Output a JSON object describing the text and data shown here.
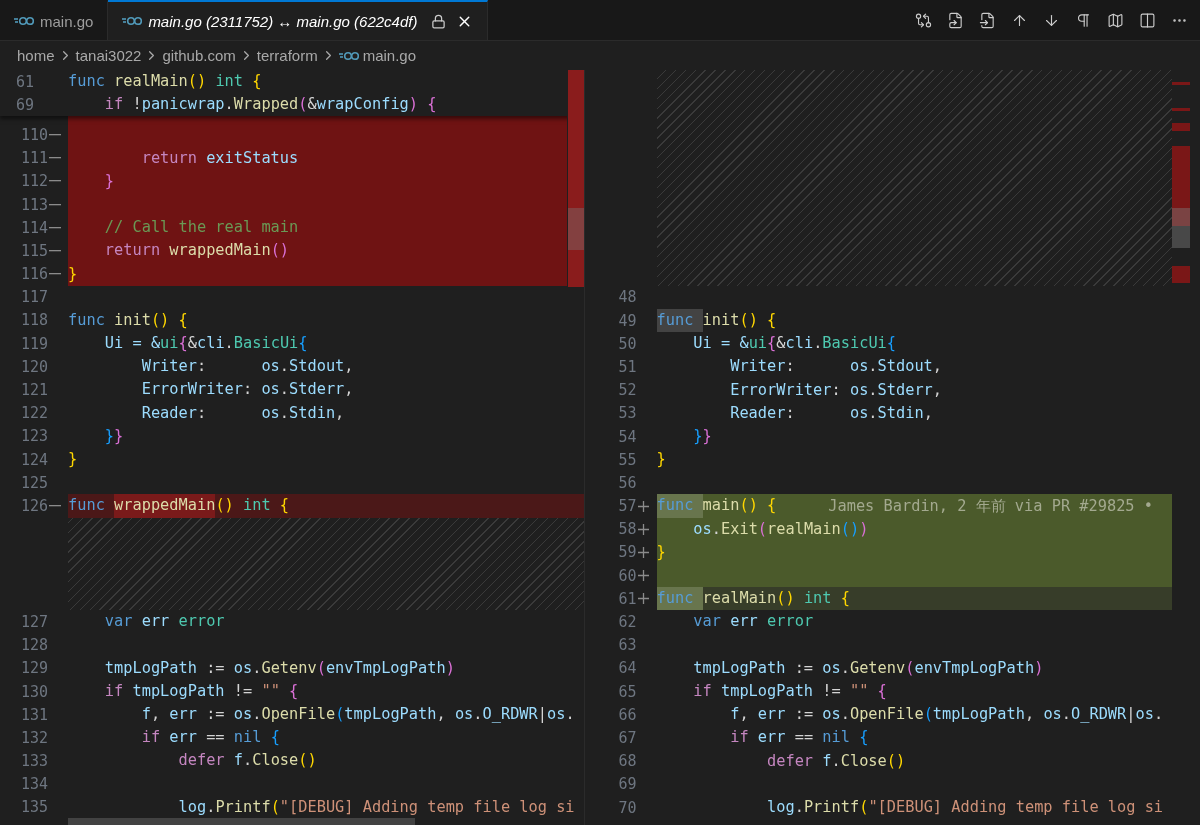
{
  "tabs": [
    {
      "label": "main.go",
      "selected": false,
      "italic": false,
      "locked": false,
      "closable": false
    },
    {
      "label": "main.go (2311752) ↔ main.go (622c4df)",
      "selected": true,
      "italic": true,
      "locked": true,
      "closable": true
    }
  ],
  "breadcrumbs": [
    {
      "label": "home",
      "file": false
    },
    {
      "label": "tanai3022",
      "file": false
    },
    {
      "label": "github.com",
      "file": false
    },
    {
      "label": "terraform",
      "file": false
    },
    {
      "label": "main.go",
      "file": true
    }
  ],
  "left": {
    "sticky": [
      {
        "num": "61",
        "tokens": [
          {
            "t": "func ",
            "kind": "kw"
          },
          {
            "t": "realMain",
            "kind": "fn"
          },
          {
            "t": "() ",
            "kind": "b1"
          },
          {
            "t": "int ",
            "kind": "ty"
          },
          {
            "t": "{",
            "kind": "b1"
          }
        ]
      },
      {
        "num": "69",
        "tokens": [
          {
            "t": "    if ",
            "kind": "ctl"
          },
          {
            "t": "!"
          },
          {
            "t": "panicwrap",
            "kind": "var"
          },
          {
            "t": "."
          },
          {
            "t": "Wrapped",
            "kind": "fn"
          },
          {
            "t": "(",
            "kind": "b2"
          },
          {
            "t": "&"
          },
          {
            "t": "wrapConfig",
            "kind": "var"
          },
          {
            "t": ") ",
            "kind": "b2"
          },
          {
            "t": "{",
            "kind": "b2"
          }
        ]
      }
    ],
    "rows": [
      {
        "kind": "removed",
        "num": "110"
      },
      {
        "kind": "removed",
        "num": "111",
        "tokens": [
          {
            "t": "        return ",
            "kind": "ctl"
          },
          {
            "t": "exitStatus",
            "kind": "var"
          }
        ]
      },
      {
        "kind": "removed",
        "num": "112",
        "tokens": [
          {
            "t": "    }",
            "kind": "b2"
          }
        ]
      },
      {
        "kind": "removed",
        "num": "113"
      },
      {
        "kind": "removed",
        "num": "114",
        "tokens": [
          {
            "t": "    // Call the real main",
            "kind": "cm"
          }
        ]
      },
      {
        "kind": "removed",
        "num": "115",
        "tokens": [
          {
            "t": "    return ",
            "kind": "ctl"
          },
          {
            "t": "wrappedMain",
            "kind": "fn"
          },
          {
            "t": "()",
            "kind": "b2"
          }
        ]
      },
      {
        "kind": "removed",
        "num": "116",
        "tokens": [
          {
            "t": "}",
            "kind": "b1"
          }
        ]
      },
      {
        "kind": "context",
        "num": "117"
      },
      {
        "kind": "context",
        "num": "118",
        "tokens": [
          {
            "t": "func ",
            "kind": "kw"
          },
          {
            "t": "init",
            "kind": "fn"
          },
          {
            "t": "() ",
            "kind": "b1"
          },
          {
            "t": "{",
            "kind": "b1"
          }
        ]
      },
      {
        "kind": "context",
        "num": "119",
        "tokens": [
          {
            "t": "    Ui = &",
            "kind": "var"
          },
          {
            "t": "ui",
            "kind": "ty"
          },
          {
            "t": "{",
            "kind": "b2"
          },
          {
            "t": "&"
          },
          {
            "t": "cli",
            "kind": "var"
          },
          {
            "t": "."
          },
          {
            "t": "BasicUi",
            "kind": "ty"
          },
          {
            "t": "{",
            "kind": "b3"
          }
        ]
      },
      {
        "kind": "context",
        "num": "120",
        "tokens": [
          {
            "t": "        Writer",
            "kind": "var"
          },
          {
            "t": ":      "
          },
          {
            "t": "os",
            "kind": "var"
          },
          {
            "t": "."
          },
          {
            "t": "Stdout",
            "kind": "var"
          },
          {
            "t": ","
          }
        ]
      },
      {
        "kind": "context",
        "num": "121",
        "tokens": [
          {
            "t": "        ErrorWriter",
            "kind": "var"
          },
          {
            "t": ": "
          },
          {
            "t": "os",
            "kind": "var"
          },
          {
            "t": "."
          },
          {
            "t": "Stderr",
            "kind": "var"
          },
          {
            "t": ","
          }
        ]
      },
      {
        "kind": "context",
        "num": "122",
        "tokens": [
          {
            "t": "        Reader",
            "kind": "var"
          },
          {
            "t": ":      "
          },
          {
            "t": "os",
            "kind": "var"
          },
          {
            "t": "."
          },
          {
            "t": "Stdin",
            "kind": "var"
          },
          {
            "t": ","
          }
        ]
      },
      {
        "kind": "context",
        "num": "123",
        "tokens": [
          {
            "t": "    }",
            "kind": "b3"
          },
          {
            "t": "}",
            "kind": "b2"
          }
        ]
      },
      {
        "kind": "context",
        "num": "124",
        "tokens": [
          {
            "t": "}",
            "kind": "b1"
          }
        ]
      },
      {
        "kind": "context",
        "num": "125"
      },
      {
        "kind": "removed-part",
        "num": "126",
        "tokens": [
          {
            "t": "func ",
            "kind": "kw"
          },
          {
            "t": "wrappedMain",
            "kind": "fn",
            "changed": true
          },
          {
            "t": "() ",
            "kind": "b1"
          },
          {
            "t": "int ",
            "kind": "ty"
          },
          {
            "t": "{",
            "kind": "b1"
          }
        ]
      },
      {
        "kind": "filler"
      },
      {
        "kind": "filler"
      },
      {
        "kind": "filler"
      },
      {
        "kind": "filler"
      },
      {
        "kind": "context",
        "num": "127",
        "tokens": [
          {
            "t": "    var ",
            "kind": "kw"
          },
          {
            "t": "err ",
            "kind": "var"
          },
          {
            "t": "error",
            "kind": "ty"
          }
        ]
      },
      {
        "kind": "context",
        "num": "128"
      },
      {
        "kind": "context",
        "num": "129",
        "tokens": [
          {
            "t": "    tmpLogPath",
            "kind": "var"
          },
          {
            "t": " := "
          },
          {
            "t": "os",
            "kind": "var"
          },
          {
            "t": "."
          },
          {
            "t": "Getenv",
            "kind": "fn"
          },
          {
            "t": "(",
            "kind": "b2"
          },
          {
            "t": "envTmpLogPath",
            "kind": "var"
          },
          {
            "t": ")",
            "kind": "b2"
          }
        ]
      },
      {
        "kind": "context",
        "num": "130",
        "tokens": [
          {
            "t": "    if ",
            "kind": "ctl"
          },
          {
            "t": "tmpLogPath",
            "kind": "var"
          },
          {
            "t": " != "
          },
          {
            "t": "\"\" ",
            "kind": "str"
          },
          {
            "t": "{",
            "kind": "b2"
          }
        ]
      },
      {
        "kind": "context",
        "num": "131",
        "tokens": [
          {
            "t": "        f",
            "kind": "var"
          },
          {
            "t": ", "
          },
          {
            "t": "err",
            "kind": "var"
          },
          {
            "t": " := "
          },
          {
            "t": "os",
            "kind": "var"
          },
          {
            "t": "."
          },
          {
            "t": "OpenFile",
            "kind": "fn"
          },
          {
            "t": "(",
            "kind": "b3"
          },
          {
            "t": "tmpLogPath",
            "kind": "var"
          },
          {
            "t": ", "
          },
          {
            "t": "os",
            "kind": "var"
          },
          {
            "t": "."
          },
          {
            "t": "O_RDWR",
            "kind": "var"
          },
          {
            "t": "|"
          },
          {
            "t": "os",
            "kind": "var"
          },
          {
            "t": "."
          }
        ]
      },
      {
        "kind": "context",
        "num": "132",
        "tokens": [
          {
            "t": "        if ",
            "kind": "ctl"
          },
          {
            "t": "err",
            "kind": "var"
          },
          {
            "t": " == "
          },
          {
            "t": "nil ",
            "kind": "kw"
          },
          {
            "t": "{",
            "kind": "b3"
          }
        ]
      },
      {
        "kind": "context",
        "num": "133",
        "tokens": [
          {
            "t": "            defer ",
            "kind": "ctl"
          },
          {
            "t": "f",
            "kind": "var"
          },
          {
            "t": "."
          },
          {
            "t": "Close",
            "kind": "fn"
          },
          {
            "t": "()",
            "kind": "b1"
          }
        ]
      },
      {
        "kind": "context",
        "num": "134"
      },
      {
        "kind": "context",
        "num": "135",
        "tokens": [
          {
            "t": "            log",
            "kind": "var"
          },
          {
            "t": "."
          },
          {
            "t": "Printf",
            "kind": "fn"
          },
          {
            "t": "(",
            "kind": "b1"
          },
          {
            "t": "\"[DEBUG] Adding temp file log si",
            "kind": "str"
          }
        ]
      }
    ]
  },
  "right": {
    "rows": [
      {
        "kind": "filler"
      },
      {
        "kind": "filler"
      },
      {
        "kind": "filler"
      },
      {
        "kind": "filler"
      },
      {
        "kind": "filler"
      },
      {
        "kind": "filler"
      },
      {
        "kind": "filler"
      },
      {
        "kind": "filler"
      },
      {
        "kind": "filler"
      },
      {
        "kind": "context",
        "num": "48"
      },
      {
        "kind": "context",
        "num": "49",
        "tokens": [
          {
            "t": "func ",
            "kind": "kw",
            "highlight": true
          },
          {
            "t": "init",
            "kind": "fn"
          },
          {
            "t": "() ",
            "kind": "b1"
          },
          {
            "t": "{",
            "kind": "b1"
          }
        ]
      },
      {
        "kind": "context",
        "num": "50",
        "tokens": [
          {
            "t": "    Ui = &",
            "kind": "var"
          },
          {
            "t": "ui",
            "kind": "ty"
          },
          {
            "t": "{",
            "kind": "b2"
          },
          {
            "t": "&"
          },
          {
            "t": "cli",
            "kind": "var"
          },
          {
            "t": "."
          },
          {
            "t": "BasicUi",
            "kind": "ty"
          },
          {
            "t": "{",
            "kind": "b3"
          }
        ]
      },
      {
        "kind": "context",
        "num": "51",
        "tokens": [
          {
            "t": "        Writer",
            "kind": "var"
          },
          {
            "t": ":      "
          },
          {
            "t": "os",
            "kind": "var"
          },
          {
            "t": "."
          },
          {
            "t": "Stdout",
            "kind": "var"
          },
          {
            "t": ","
          }
        ]
      },
      {
        "kind": "context",
        "num": "52",
        "tokens": [
          {
            "t": "        ErrorWriter",
            "kind": "var"
          },
          {
            "t": ": "
          },
          {
            "t": "os",
            "kind": "var"
          },
          {
            "t": "."
          },
          {
            "t": "Stderr",
            "kind": "var"
          },
          {
            "t": ","
          }
        ]
      },
      {
        "kind": "context",
        "num": "53",
        "tokens": [
          {
            "t": "        Reader",
            "kind": "var"
          },
          {
            "t": ":      "
          },
          {
            "t": "os",
            "kind": "var"
          },
          {
            "t": "."
          },
          {
            "t": "Stdin",
            "kind": "var"
          },
          {
            "t": ","
          }
        ]
      },
      {
        "kind": "context",
        "num": "54",
        "tokens": [
          {
            "t": "    }",
            "kind": "b3"
          },
          {
            "t": "}",
            "kind": "b2"
          }
        ]
      },
      {
        "kind": "context",
        "num": "55",
        "tokens": [
          {
            "t": "}",
            "kind": "b1"
          }
        ]
      },
      {
        "kind": "context",
        "num": "56"
      },
      {
        "kind": "added",
        "num": "57",
        "tokens": [
          {
            "t": "func ",
            "kind": "kw",
            "highlight": true
          },
          {
            "t": "main",
            "kind": "fn"
          },
          {
            "t": "() ",
            "kind": "b1"
          },
          {
            "t": "{",
            "kind": "b1"
          }
        ],
        "annotation": "James Bardin, 2 年前 via PR #29825 •"
      },
      {
        "kind": "added",
        "num": "58",
        "tokens": [
          {
            "t": "    os",
            "kind": "var"
          },
          {
            "t": "."
          },
          {
            "t": "Exit",
            "kind": "fn"
          },
          {
            "t": "(",
            "kind": "b2"
          },
          {
            "t": "realMain",
            "kind": "fn"
          },
          {
            "t": "()",
            "kind": "b3"
          },
          {
            "t": ")",
            "kind": "b2"
          }
        ]
      },
      {
        "kind": "added",
        "num": "59",
        "tokens": [
          {
            "t": "}",
            "kind": "b1"
          }
        ]
      },
      {
        "kind": "added",
        "num": "60"
      },
      {
        "kind": "added-part",
        "num": "61",
        "tokens": [
          {
            "t": "func ",
            "kind": "kw",
            "highlight": true,
            "changed": true
          },
          {
            "t": "realMain",
            "kind": "fn"
          },
          {
            "t": "() ",
            "kind": "b1"
          },
          {
            "t": "int ",
            "kind": "ty"
          },
          {
            "t": "{",
            "kind": "b1"
          }
        ]
      },
      {
        "kind": "context",
        "num": "62",
        "tokens": [
          {
            "t": "    var ",
            "kind": "kw"
          },
          {
            "t": "err ",
            "kind": "var"
          },
          {
            "t": "error",
            "kind": "ty"
          }
        ]
      },
      {
        "kind": "context",
        "num": "63"
      },
      {
        "kind": "context",
        "num": "64",
        "tokens": [
          {
            "t": "    tmpLogPath",
            "kind": "var"
          },
          {
            "t": " := "
          },
          {
            "t": "os",
            "kind": "var"
          },
          {
            "t": "."
          },
          {
            "t": "Getenv",
            "kind": "fn"
          },
          {
            "t": "(",
            "kind": "b2"
          },
          {
            "t": "envTmpLogPath",
            "kind": "var"
          },
          {
            "t": ")",
            "kind": "b2"
          }
        ]
      },
      {
        "kind": "context",
        "num": "65",
        "tokens": [
          {
            "t": "    if ",
            "kind": "ctl"
          },
          {
            "t": "tmpLogPath",
            "kind": "var"
          },
          {
            "t": " != "
          },
          {
            "t": "\"\" ",
            "kind": "str"
          },
          {
            "t": "{",
            "kind": "b2"
          }
        ]
      },
      {
        "kind": "context",
        "num": "66",
        "tokens": [
          {
            "t": "        f",
            "kind": "var"
          },
          {
            "t": ", "
          },
          {
            "t": "err",
            "kind": "var"
          },
          {
            "t": " := "
          },
          {
            "t": "os",
            "kind": "var"
          },
          {
            "t": "."
          },
          {
            "t": "OpenFile",
            "kind": "fn"
          },
          {
            "t": "(",
            "kind": "b3"
          },
          {
            "t": "tmpLogPath",
            "kind": "var"
          },
          {
            "t": ", "
          },
          {
            "t": "os",
            "kind": "var"
          },
          {
            "t": "."
          },
          {
            "t": "O_RDWR",
            "kind": "var"
          },
          {
            "t": "|"
          },
          {
            "t": "os",
            "kind": "var"
          },
          {
            "t": "."
          }
        ]
      },
      {
        "kind": "context",
        "num": "67",
        "tokens": [
          {
            "t": "        if ",
            "kind": "ctl"
          },
          {
            "t": "err",
            "kind": "var"
          },
          {
            "t": " == "
          },
          {
            "t": "nil ",
            "kind": "kw"
          },
          {
            "t": "{",
            "kind": "b3"
          }
        ]
      },
      {
        "kind": "context",
        "num": "68",
        "tokens": [
          {
            "t": "            defer ",
            "kind": "ctl"
          },
          {
            "t": "f",
            "kind": "var"
          },
          {
            "t": "."
          },
          {
            "t": "Close",
            "kind": "fn"
          },
          {
            "t": "()",
            "kind": "b1"
          }
        ]
      },
      {
        "kind": "context",
        "num": "69"
      },
      {
        "kind": "context",
        "num": "70",
        "tokens": [
          {
            "t": "            log",
            "kind": "var"
          },
          {
            "t": "."
          },
          {
            "t": "Printf",
            "kind": "fn"
          },
          {
            "t": "(",
            "kind": "b1"
          },
          {
            "t": "\"[DEBUG] Adding temp file log si",
            "kind": "str"
          }
        ]
      }
    ]
  }
}
